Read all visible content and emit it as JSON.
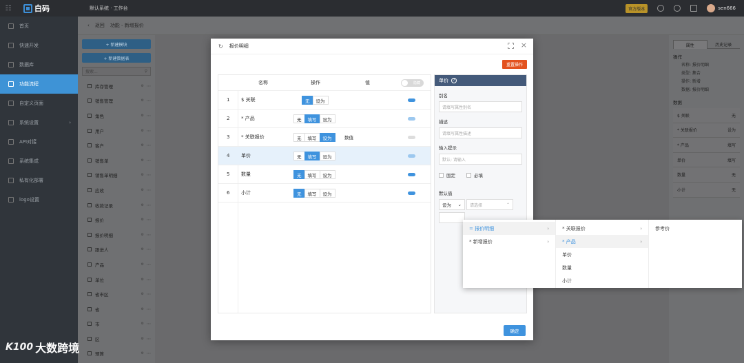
{
  "topbar": {
    "logo_text": "白码",
    "system_title": "默认系统 · 工作台",
    "upgrade_label": "官方版本",
    "username": "sen666"
  },
  "sidebar": {
    "items": [
      {
        "label": "首页"
      },
      {
        "label": "快速开发"
      },
      {
        "label": "数据库"
      },
      {
        "label": "功能流程"
      },
      {
        "label": "自定义页面"
      },
      {
        "label": "系统设置"
      },
      {
        "label": "API对接"
      },
      {
        "label": "系统集成"
      },
      {
        "label": "私有化部署"
      },
      {
        "label": "logo设置"
      }
    ]
  },
  "breadcrumb": {
    "back": "返回",
    "path": "功能 - 新增报价"
  },
  "left_panel": {
    "new_module": "+ 新建模块",
    "new_table": "+ 新建数据表",
    "search_placeholder": "搜索...",
    "items": [
      {
        "label": "库存管理"
      },
      {
        "label": "销售管理"
      },
      {
        "label": "角色"
      },
      {
        "label": "用户"
      },
      {
        "label": "客户"
      },
      {
        "label": "销售单"
      },
      {
        "label": "销售单明细"
      },
      {
        "label": "应收"
      },
      {
        "label": "收款记录"
      },
      {
        "label": "报价"
      },
      {
        "label": "报价明细"
      },
      {
        "label": "跟进人"
      },
      {
        "label": "产品"
      },
      {
        "label": "单位"
      },
      {
        "label": "省市区"
      },
      {
        "label": "省"
      },
      {
        "label": "市"
      },
      {
        "label": "区"
      },
      {
        "label": "预算"
      }
    ]
  },
  "right_panel": {
    "tabs": [
      {
        "label": "属性"
      },
      {
        "label": "历史记录"
      }
    ],
    "operation_title": "操作",
    "kv": [
      {
        "text": "名称: 报价明细"
      },
      {
        "text": "类型: 集合"
      },
      {
        "text": "操作: 新增"
      },
      {
        "text": "数据: 报价明细"
      }
    ],
    "data_title": "数据",
    "rows": [
      {
        "name": "$ 关联",
        "value": "无"
      },
      {
        "name": "* 关联报价",
        "value": "设为"
      },
      {
        "name": "* 产品",
        "value": "填写"
      },
      {
        "name": "单价",
        "value": "填写"
      },
      {
        "name": "数量",
        "value": "无"
      },
      {
        "name": "小计",
        "value": "无"
      }
    ]
  },
  "modal": {
    "title": "报价明细",
    "reset_label": "重置操作",
    "ok_label": "确定",
    "table": {
      "col_name": "名称",
      "col_op": "操作",
      "col_val": "值",
      "toggle_label": "隐藏",
      "rows": [
        {
          "num": "1",
          "name": "$ 关联",
          "ops": [
            "无",
            "设为"
          ],
          "selected": "无",
          "value": "",
          "switch": "on"
        },
        {
          "num": "2",
          "name": "* 产品",
          "ops": [
            "无",
            "填写",
            "设为"
          ],
          "selected": "填写",
          "value": "",
          "switch": "light"
        },
        {
          "num": "3",
          "name": "* 关联报价",
          "ops": [
            "无",
            "填写",
            "设为"
          ],
          "selected": "设为",
          "value": "数值",
          "switch": "off"
        },
        {
          "num": "4",
          "name": "单价",
          "ops": [
            "无",
            "填写",
            "设为"
          ],
          "selected": "填写",
          "value": "",
          "switch": "light"
        },
        {
          "num": "5",
          "name": "数量",
          "ops": [
            "无",
            "填写",
            "设为"
          ],
          "selected": "无",
          "value": "",
          "switch": "on"
        },
        {
          "num": "6",
          "name": "小计",
          "ops": [
            "无",
            "填写",
            "设为"
          ],
          "selected": "无",
          "value": "",
          "switch": "on"
        }
      ]
    },
    "props": {
      "title": "单价",
      "alias_label": "别名",
      "alias_placeholder": "请填写属性别名",
      "desc_label": "描述",
      "desc_placeholder": "请填写属性描述",
      "hint_label": "输入提示",
      "hint_placeholder": "默认: 请输入",
      "fixed_label": "固定",
      "required_label": "必填",
      "default_label": "默认值",
      "default_select": "设为",
      "default_placeholder": "请选择"
    }
  },
  "cascader": {
    "col1": [
      {
        "label": "= 报价明细"
      },
      {
        "label": "* 新增报价"
      }
    ],
    "col2": [
      {
        "label": "* 关联报价"
      },
      {
        "label": "* 产品"
      },
      {
        "label": "单价"
      },
      {
        "label": "数量"
      },
      {
        "label": "小计"
      }
    ],
    "col3": [
      {
        "label": "参考价"
      }
    ]
  },
  "watermark": {
    "logo": "K100",
    "text": "大数跨境"
  },
  "colors": {
    "accent": "#3f93de",
    "danger": "#e3521f",
    "sidebar_bg": "#30353b",
    "topbar_bg": "#2b2d31"
  }
}
